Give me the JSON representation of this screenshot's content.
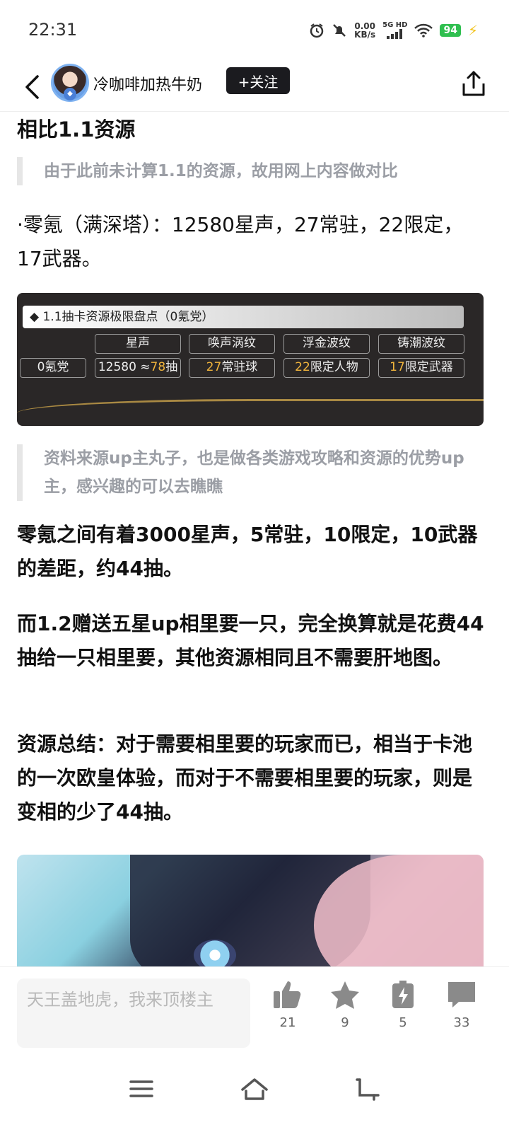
{
  "status_bar": {
    "time": "22:31",
    "net_speed_value": "0.00",
    "net_speed_unit": "KB/s",
    "network": "5G HD",
    "battery": "94"
  },
  "header": {
    "author_name": "冷咖啡加热牛奶",
    "follow_label": "+关注",
    "icons": [
      "back-arrow-icon",
      "share-icon"
    ]
  },
  "article": {
    "section_heading": "相比1.1资源",
    "quote_1": "由于此前未计算1.1的资源，故用网上内容做对比",
    "para_1": "·零氪（满深塔）：12580星声，27常驻，22限定，17武器。",
    "resource_card": {
      "title": "◆ 1.1抽卡资源极限盘点（0氪党）",
      "headers": [
        "星声",
        "唤声涡纹",
        "浮金波纹",
        "铸潮波纹"
      ],
      "row_label": "0氪党",
      "cells": [
        {
          "num": "12580 ≈",
          "gold": "78",
          "suffix": "抽"
        },
        {
          "num": "",
          "gold": "27",
          "suffix": "常驻球"
        },
        {
          "num": "",
          "gold": "22",
          "suffix": "限定人物"
        },
        {
          "num": "",
          "gold": "17",
          "suffix": "限定武器"
        }
      ]
    },
    "quote_2": "资料来源up主丸子，也是做各类游戏攻略和资源的优势up主，感兴趣的可以去瞧瞧",
    "bold_1": "零氪之间有着3000星声，5常驻，10限定，10武器的差距，约44抽。",
    "bold_2": "而1.2赠送五星up相里要一只，完全换算就是花费44抽给一只相里要，其他资源相同且不需要肝地图。",
    "bold_3": "资源总结：对于需要相里要的玩家而已，相当于卡池的一次欧皇体验，而对于不需要相里要的玩家，则是变相的少了44抽。"
  },
  "bottom_bar": {
    "comment_placeholder": "天王盖地虎，我来顶楼主",
    "like_count": "21",
    "star_count": "9",
    "charge_count": "5",
    "comment_count": "33"
  }
}
